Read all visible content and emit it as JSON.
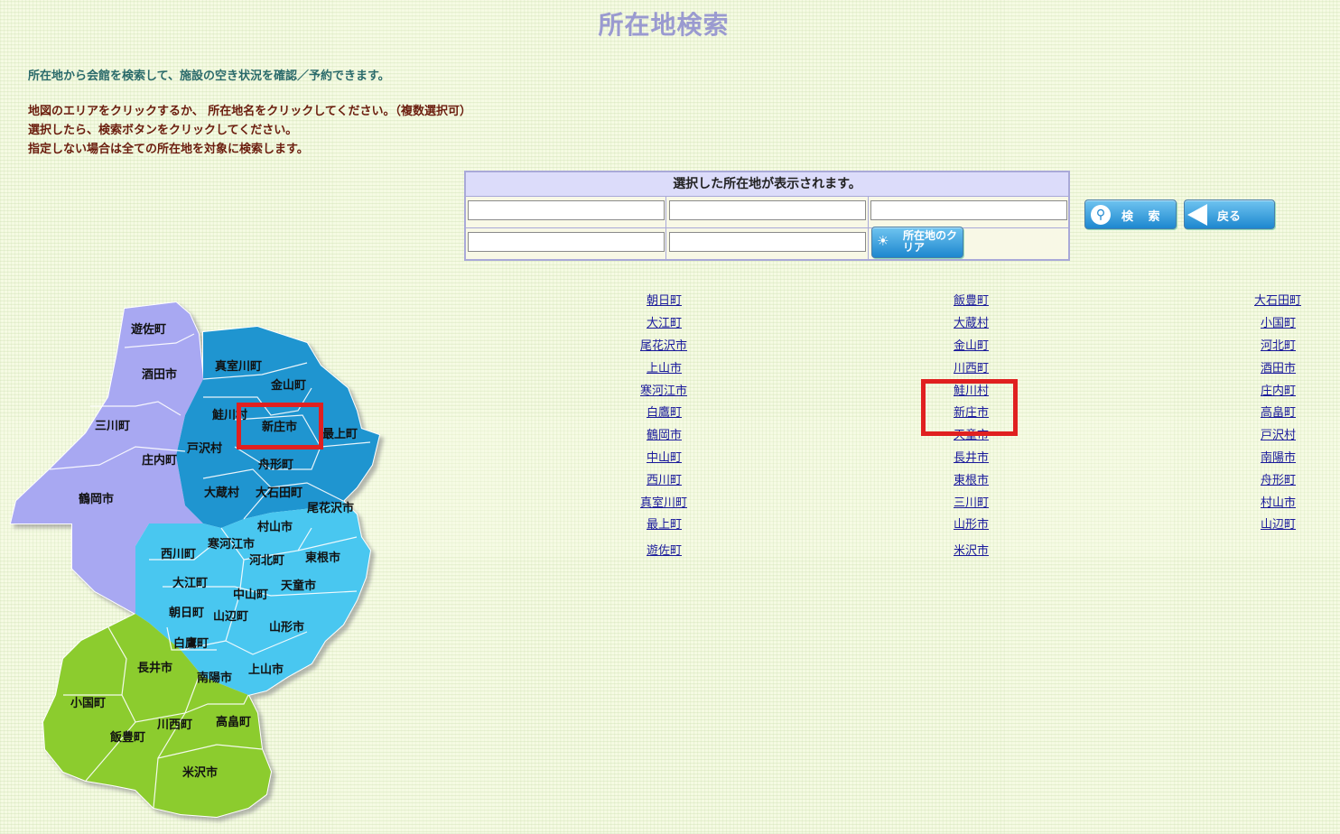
{
  "title": "所在地検索",
  "intro": "所在地から会館を検索して、施設の空き状況を確認／予約できます。",
  "instructions": [
    "地図のエリアをクリックするか、 所在地名をクリックしてください。（複数選択可）",
    "選択したら、検索ボタンをクリックしてください。",
    "指定しない場合は全ての所在地を対象に検索します。"
  ],
  "selection": {
    "header": "選択した所在地が表示されます。",
    "slots": [
      "",
      "",
      "",
      "",
      ""
    ],
    "clear_button": "所在地のクリア"
  },
  "buttons": {
    "search": "検 索",
    "back": "戻る"
  },
  "locations": {
    "col1": [
      "朝日町",
      "大江町",
      "尾花沢市",
      "上山市",
      "寒河江市",
      "白鷹町",
      "鶴岡市",
      "中山町",
      "西川町",
      "真室川町",
      "最上町",
      "遊佐町"
    ],
    "col2": [
      "飯豊町",
      "大蔵村",
      "金山町",
      "川西町",
      "鮭川村",
      "新庄市",
      "天童市",
      "長井市",
      "東根市",
      "三川町",
      "山形市",
      "米沢市"
    ],
    "col3": [
      "大石田町",
      "小国町",
      "河北町",
      "酒田市",
      "庄内町",
      "高畠町",
      "戸沢村",
      "南陽市",
      "舟形町",
      "村山市",
      "山辺町"
    ]
  },
  "map": {
    "colors": {
      "shonai": "#a8a8f2",
      "mogami": "#1f95d0",
      "murayama": "#49c7f0",
      "okitama": "#8ccc2e"
    },
    "labels": [
      "遊佐町",
      "酒田市",
      "三川町",
      "庄内町",
      "鶴岡市",
      "真室川町",
      "金山町",
      "鮭川村",
      "新庄市",
      "最上町",
      "戸沢村",
      "舟形町",
      "大蔵村",
      "大石田町",
      "尾花沢市",
      "村山市",
      "寒河江市",
      "西川町",
      "河北町",
      "東根市",
      "大江町",
      "中山町",
      "天童市",
      "朝日町",
      "山辺町",
      "山形市",
      "白鷹町",
      "長井市",
      "南陽市",
      "上山市",
      "小国町",
      "川西町",
      "高畠町",
      "飯豊町",
      "米沢市"
    ]
  }
}
